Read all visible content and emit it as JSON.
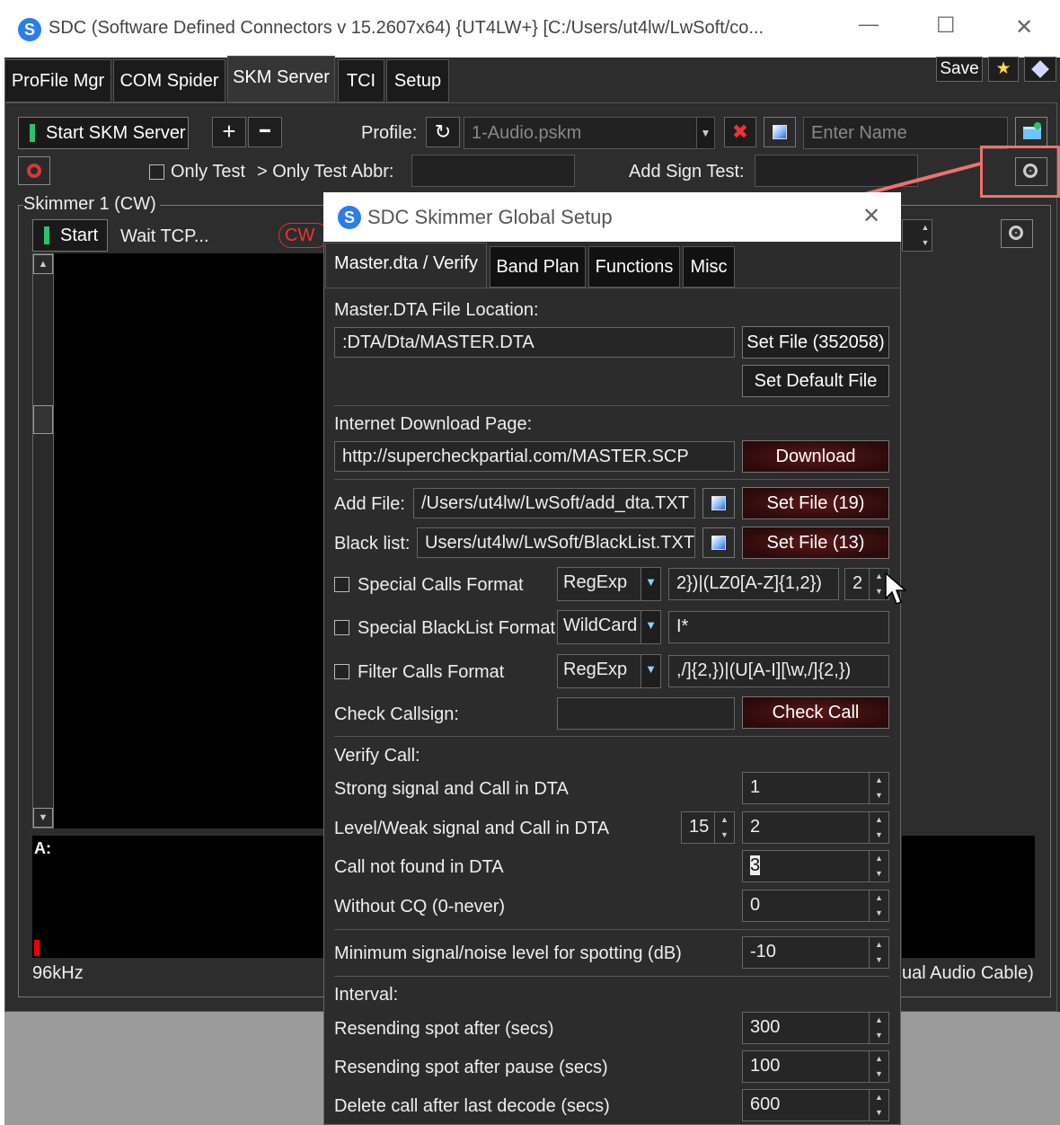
{
  "window": {
    "title": "SDC (Software Defined Connectors v 15.2607x64) {UT4LW+} [C:/Users/ut4lw/LwSoft/co...",
    "logo": "S",
    "minimize": "—",
    "maximize": "☐",
    "close": "✕"
  },
  "tabs": [
    "ProFile Mgr",
    "COM Spider",
    "SKM Server",
    "TCI",
    "Setup"
  ],
  "topright": {
    "save": "Save",
    "star": "★"
  },
  "toolbar": {
    "start_server": "Start SKM Server",
    "plus": "+",
    "minus": "━",
    "profile_label": "Profile:",
    "profile_value": "1-Audio.pskm",
    "name_placeholder": "Enter Name",
    "only_test": "Only Test",
    "only_test_abbr": "> Only Test Abbr:",
    "add_sign_test": "Add Sign Test:"
  },
  "skimmer": {
    "group": "Skimmer 1 (CW)",
    "start": "Start",
    "status": "Wait TCP...",
    "mode": "CW",
    "channel": "A:",
    "freq": "96kHz",
    "device_tail": "ual Audio Cable)"
  },
  "dialog": {
    "logo": "S",
    "title": "SDC Skimmer Global Setup",
    "close": "✕",
    "tabs": [
      "Master.dta / Verify",
      "Band Plan",
      "Functions",
      "Misc"
    ],
    "master_location_label": "Master.DTA File Location:",
    "master_path": ":DTA/Dta/MASTER.DTA",
    "set_file": "Set File (352058)",
    "set_default": "Set Default File",
    "download_label": "Internet Download Page:",
    "download_url": "http://supercheckpartial.com/MASTER.SCP",
    "download_btn": "Download",
    "add_file_label": "Add File:",
    "add_file_path": "/Users/ut4lw/LwSoft/add_dta.TXT",
    "add_file_btn": "Set File (19)",
    "blacklist_label": "Black list:",
    "blacklist_path": "Users/ut4lw/LwSoft/BlackList.TXT",
    "blacklist_btn": "Set File (13)",
    "special_calls": "Special Calls Format",
    "special_calls_mode": "RegExp",
    "special_calls_expr": "2})|(LZ0[A-Z]{1,2})",
    "special_calls_num": "2",
    "special_black": "Special BlackList Format",
    "special_black_mode": "WildCard",
    "special_black_expr": "I*",
    "filter_calls": "Filter Calls Format",
    "filter_calls_mode": "RegExp",
    "filter_calls_expr": ",/]{2,})|(U[A-I][\\w,/]{2,})",
    "check_callsign": "Check Callsign:",
    "check_call_btn": "Check Call",
    "verify_label": "Verify Call:",
    "strong_label": "Strong signal and Call in DTA",
    "strong_val": "1",
    "weak_label": "Level/Weak signal and Call in DTA",
    "weak_level": "15",
    "weak_val": "2",
    "notfound_label": "Call not found in DTA",
    "notfound_val": "3",
    "withoutcq_label": "Without CQ (0-never)",
    "withoutcq_val": "0",
    "min_snr_label": "Minimum signal/noise level for spotting (dB)",
    "min_snr_val": "-10",
    "interval_label": "Interval:",
    "resend_label": "Resending spot after (secs)",
    "resend_val": "300",
    "resend_pause_label": "Resending spot after pause (secs)",
    "resend_pause_val": "100",
    "delete_label": "Delete call after last decode (secs)",
    "delete_val": "600"
  },
  "colors": {
    "highlight": "#f07070",
    "accent_green": "#2bc26a"
  }
}
